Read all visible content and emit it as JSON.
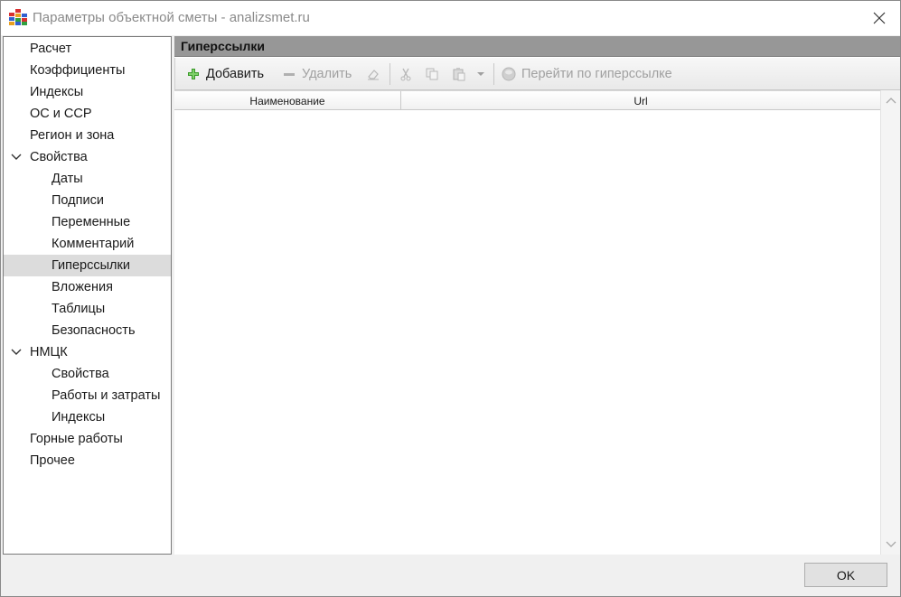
{
  "window": {
    "title": "Параметры объектной сметы - analizsmet.ru"
  },
  "nav": {
    "items": [
      {
        "label": "Расчет",
        "level": 0,
        "expandable": false,
        "selected": false
      },
      {
        "label": "Коэффициенты",
        "level": 0,
        "expandable": false,
        "selected": false
      },
      {
        "label": "Индексы",
        "level": 0,
        "expandable": false,
        "selected": false
      },
      {
        "label": "ОС и ССР",
        "level": 0,
        "expandable": false,
        "selected": false
      },
      {
        "label": "Регион и зона",
        "level": 0,
        "expandable": false,
        "selected": false
      },
      {
        "label": "Свойства",
        "level": 0,
        "expandable": true,
        "selected": false
      },
      {
        "label": "Даты",
        "level": 1,
        "expandable": false,
        "selected": false
      },
      {
        "label": "Подписи",
        "level": 1,
        "expandable": false,
        "selected": false
      },
      {
        "label": "Переменные",
        "level": 1,
        "expandable": false,
        "selected": false
      },
      {
        "label": "Комментарий",
        "level": 1,
        "expandable": false,
        "selected": false
      },
      {
        "label": "Гиперссылки",
        "level": 1,
        "expandable": false,
        "selected": true
      },
      {
        "label": "Вложения",
        "level": 1,
        "expandable": false,
        "selected": false
      },
      {
        "label": "Таблицы",
        "level": 1,
        "expandable": false,
        "selected": false
      },
      {
        "label": "Безопасность",
        "level": 1,
        "expandable": false,
        "selected": false
      },
      {
        "label": "НМЦК",
        "level": 0,
        "expandable": true,
        "selected": false
      },
      {
        "label": "Свойства",
        "level": 1,
        "expandable": false,
        "selected": false
      },
      {
        "label": "Работы и затраты",
        "level": 1,
        "expandable": false,
        "selected": false
      },
      {
        "label": "Индексы",
        "level": 1,
        "expandable": false,
        "selected": false
      },
      {
        "label": "Горные работы",
        "level": 0,
        "expandable": false,
        "selected": false
      },
      {
        "label": "Прочее",
        "level": 0,
        "expandable": false,
        "selected": false
      }
    ]
  },
  "section": {
    "title": "Гиперссылки"
  },
  "toolbar": {
    "add_label": "Добавить",
    "delete_label": "Удалить",
    "goto_label": "Перейти по гиперссылке"
  },
  "grid": {
    "columns": [
      "Наименование",
      "Url"
    ],
    "rows": []
  },
  "footer": {
    "ok_label": "OK"
  },
  "colors": {
    "add_icon": "#3a9a2a",
    "selected_bg": "#dcdcdc",
    "header_bg": "#979797"
  }
}
